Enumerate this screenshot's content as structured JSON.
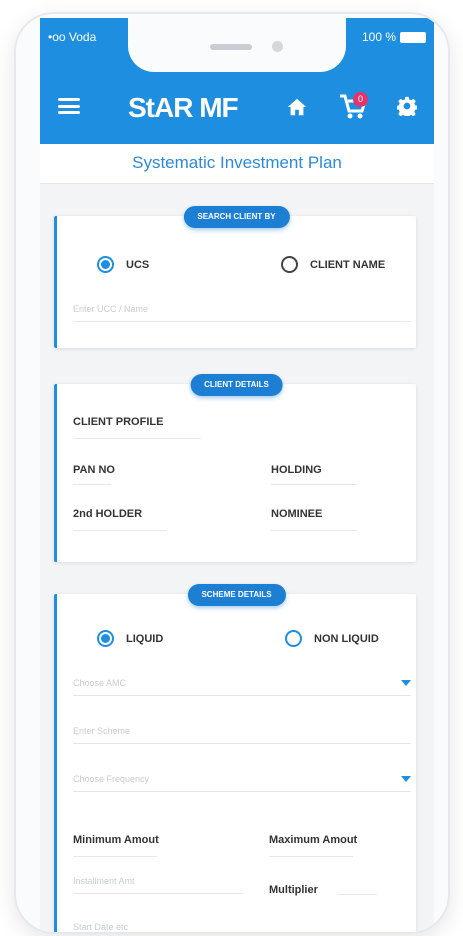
{
  "status_bar": {
    "carrier": "•oo Voda",
    "battery": "100 %"
  },
  "app_bar": {
    "logo": "StAR MF",
    "cart_count": "0"
  },
  "page_title": "Systematic Investment Plan",
  "search_section": {
    "header": "SEARCH CLIENT BY",
    "options": [
      "UCS",
      "CLIENT NAME"
    ],
    "selected": "UCS",
    "placeholder": "Enter UCC / Name"
  },
  "client_section": {
    "header": "CLIENT DETAILS",
    "client_profile": "CLIENT PROFILE",
    "pan_no": "PAN NO",
    "holding": "HOLDING",
    "second_holder": "2nd HOLDER",
    "nominee": "NOMINEE"
  },
  "scheme_section": {
    "header": "SCHEME DETAILS",
    "options": [
      "LIQUID",
      "NON LIQUID"
    ],
    "selected": "LIQUID",
    "amc_placeholder": "Choose AMC",
    "scheme_placeholder": "Enter Scheme",
    "frequency_placeholder": "Choose Frequency",
    "min_amount": "Minimum Amout",
    "max_amount": "Maximum Amout",
    "installment_placeholder": "Installment Amt",
    "multiplier": "Multiplier",
    "last_placeholder": "Start Date etc"
  },
  "colors": {
    "primary": "#1e8fe0",
    "badge": "#e2356b"
  }
}
